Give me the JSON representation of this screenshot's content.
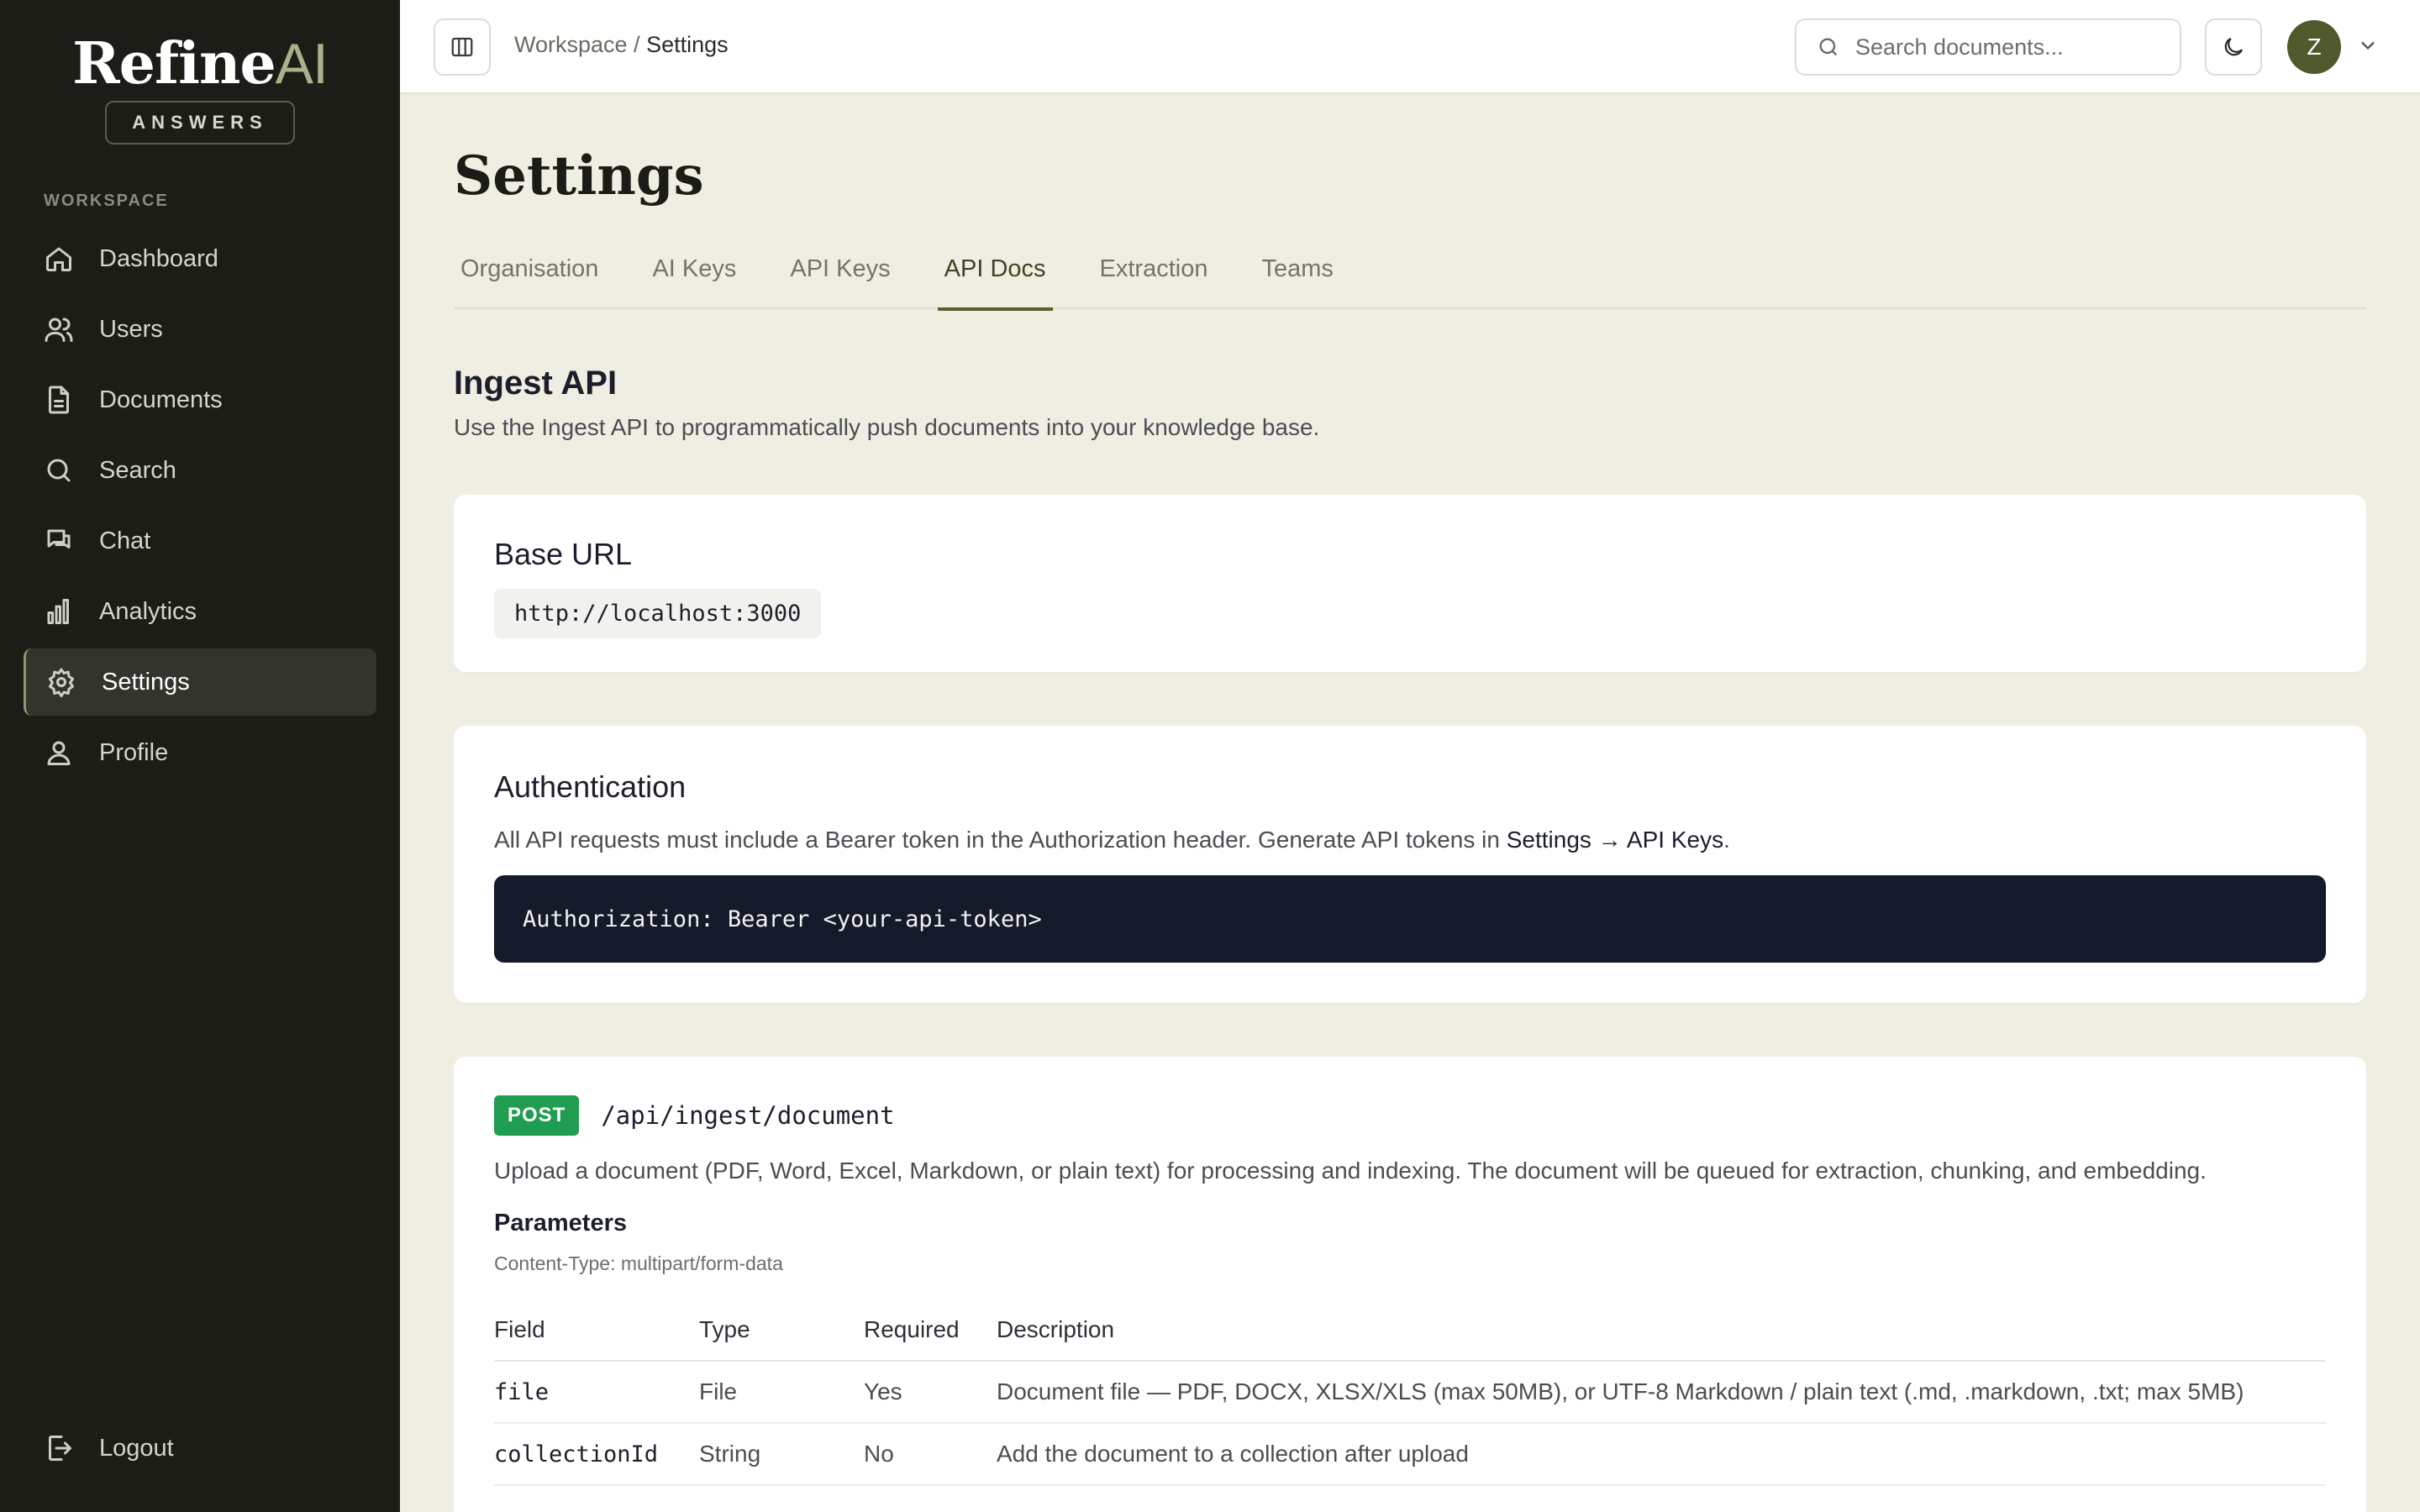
{
  "brand": {
    "name": "Refine",
    "name_accent": "AI",
    "badge": "ANSWERS"
  },
  "sidebar": {
    "section_label": "WORKSPACE",
    "items": [
      {
        "label": "Dashboard",
        "icon": "home-icon"
      },
      {
        "label": "Users",
        "icon": "users-icon"
      },
      {
        "label": "Documents",
        "icon": "document-icon"
      },
      {
        "label": "Search",
        "icon": "search-icon"
      },
      {
        "label": "Chat",
        "icon": "chat-icon"
      },
      {
        "label": "Analytics",
        "icon": "bar-chart-icon"
      },
      {
        "label": "Settings",
        "icon": "gear-icon",
        "active": true
      },
      {
        "label": "Profile",
        "icon": "user-icon"
      }
    ],
    "logout_label": "Logout"
  },
  "topbar": {
    "breadcrumb_root": "Workspace /",
    "breadcrumb_current": "Settings",
    "search_placeholder": "Search documents...",
    "avatar_initial": "Z"
  },
  "page": {
    "title": "Settings",
    "tabs": [
      "Organisation",
      "AI Keys",
      "API Keys",
      "API Docs",
      "Extraction",
      "Teams"
    ],
    "active_tab": "API Docs"
  },
  "ingest": {
    "title": "Ingest API",
    "description": "Use the Ingest API to programmatically push documents into your knowledge base."
  },
  "base_url": {
    "title": "Base URL",
    "value": "http://localhost:3000"
  },
  "auth": {
    "title": "Authentication",
    "text_before": "All API requests must include a Bearer token in the Authorization header. Generate API tokens in ",
    "link": "Settings → API Keys",
    "text_after": ".",
    "code": "Authorization: Bearer <your-api-token>"
  },
  "endpoint": {
    "method": "POST",
    "path": "/api/ingest/document",
    "description": "Upload a document (PDF, Word, Excel, Markdown, or plain text) for processing and indexing. The document will be queued for extraction, chunking, and embedding.",
    "params_title": "Parameters",
    "content_type": "Content-Type: multipart/form-data",
    "columns": [
      "Field",
      "Type",
      "Required",
      "Description"
    ],
    "rows": [
      {
        "field": "file",
        "type": "File",
        "required": "Yes",
        "description": "Document file — PDF, DOCX, XLSX/XLS (max 50MB), or UTF-8 Markdown / plain text (.md, .markdown, .txt; max 5MB)"
      },
      {
        "field": "collectionId",
        "type": "String",
        "required": "No",
        "description": "Add the document to a collection after upload"
      }
    ]
  },
  "colors": {
    "sidebar_bg": "#1c1d16",
    "accent": "#55602e",
    "post_badge": "#1f9d50",
    "code_bg": "#141a2a"
  }
}
